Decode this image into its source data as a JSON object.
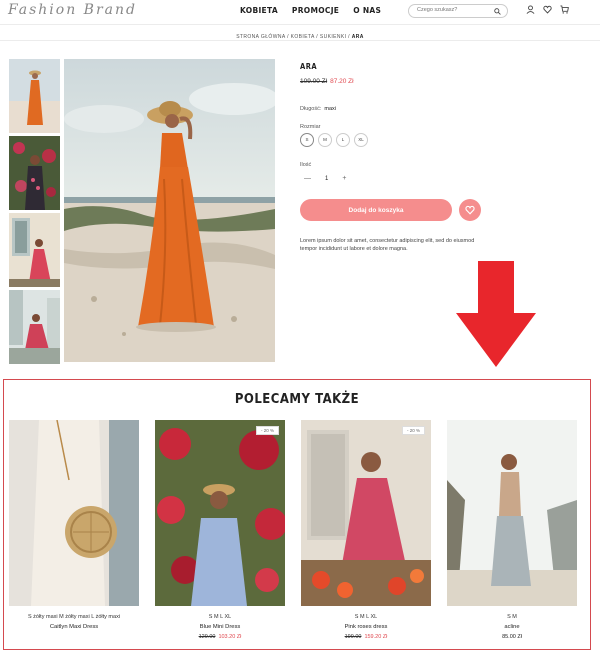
{
  "header": {
    "logo": "Fashion Brand",
    "nav": [
      "KOBIETA",
      "PROMOCJE",
      "O NAS"
    ],
    "search_placeholder": "Czego szukasz?",
    "icons": [
      "user-icon",
      "heart-icon",
      "cart-icon"
    ]
  },
  "breadcrumb": {
    "path": "STRONA GŁÓWNA / KOBIETA / SUKIENKI / ",
    "current": "ARA"
  },
  "product": {
    "title": "ARA",
    "old_price": "109.00 Zł",
    "new_price": "87.20 Zł",
    "length_label": "Długość:",
    "length_value": "maxi",
    "size_label": "Rozmiar",
    "sizes": [
      "S",
      "M",
      "L",
      "XL"
    ],
    "qty_label": "Ilość",
    "qty_minus": "—",
    "qty_value": "1",
    "qty_plus": "+",
    "add_to_cart": "Dodaj do koszyka",
    "description": "Lorem ipsum dolor sit amet, consectetur adipiscing elit, sed do eiusmod tempor incididunt ut labore et dolore magna."
  },
  "recommendations": {
    "title": "POLECAMY TAKŻE",
    "items": [
      {
        "sizes": "S żółty maxi   M żółty maxi   L żółty maxi",
        "name": "Caitlyn Maxi Dress",
        "old_price": "",
        "price": "",
        "discount": ""
      },
      {
        "sizes": "S  M  L  XL",
        "name": "Blue Mini Dress",
        "old_price": "129.00",
        "price": "103.20 Zł",
        "discount": "- 20 %"
      },
      {
        "sizes": "S  M  L  XL",
        "name": "Pink roses dress",
        "old_price": "199.00",
        "price": "159.20 Zł",
        "discount": "- 20 %"
      },
      {
        "sizes": "S  M",
        "name": "acline",
        "old_price": "",
        "price": "85.00 Zł",
        "discount": ""
      }
    ]
  },
  "colors": {
    "accent": "#f58d8d",
    "sale": "#e0484f",
    "highlight": "#e8262c"
  }
}
